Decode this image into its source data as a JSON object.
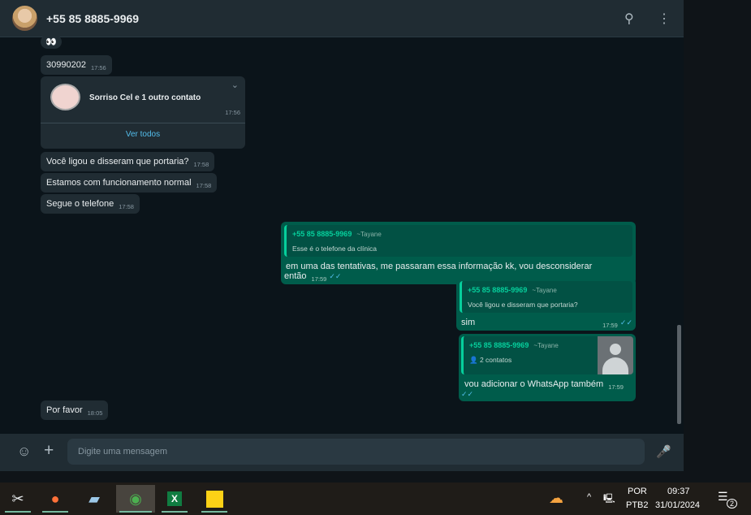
{
  "header": {
    "contact": "+55 85 8885-9969"
  },
  "messages_in": [
    {
      "text": "👀"
    },
    {
      "text": "30990202",
      "time": "17:56"
    },
    {
      "text": "Você ligou e disseram que portaria?",
      "time": "17:58"
    },
    {
      "text": "Estamos com funcionamento normal",
      "time": "17:58"
    },
    {
      "text": "Segue o telefone",
      "time": "17:58"
    },
    {
      "text": "Por favor",
      "time": "18:05"
    }
  ],
  "contact_card": {
    "name": "Sorriso Cel e 1 outro contato",
    "time": "17:56",
    "action": "Ver todos"
  },
  "messages_out": [
    {
      "quote_name": "+55 85 8885-9969",
      "quote_alias": "~Tayane",
      "quote_text": "Esse é o telefone da clínica",
      "text": "em uma das tentativas, me passaram essa informação kk, vou desconsiderar então",
      "time": "17:59"
    },
    {
      "quote_name": "+55 85 8885-9969",
      "quote_alias": "~Tayane",
      "quote_text": "Você ligou e disseram que portaria?",
      "text": "sim",
      "time": "17:59"
    },
    {
      "quote_name": "+55 85 8885-9969",
      "quote_alias": "~Tayane",
      "quote_text": "2 contatos",
      "text": "vou adicionar o WhatsApp também",
      "time": "17:59"
    }
  ],
  "input": {
    "placeholder": "Digite uma mensagem"
  },
  "taskbar": {
    "lang1": "POR",
    "lang2": "PTB2",
    "time": "09:37",
    "date": "31/01/2024",
    "notifications": "2"
  }
}
